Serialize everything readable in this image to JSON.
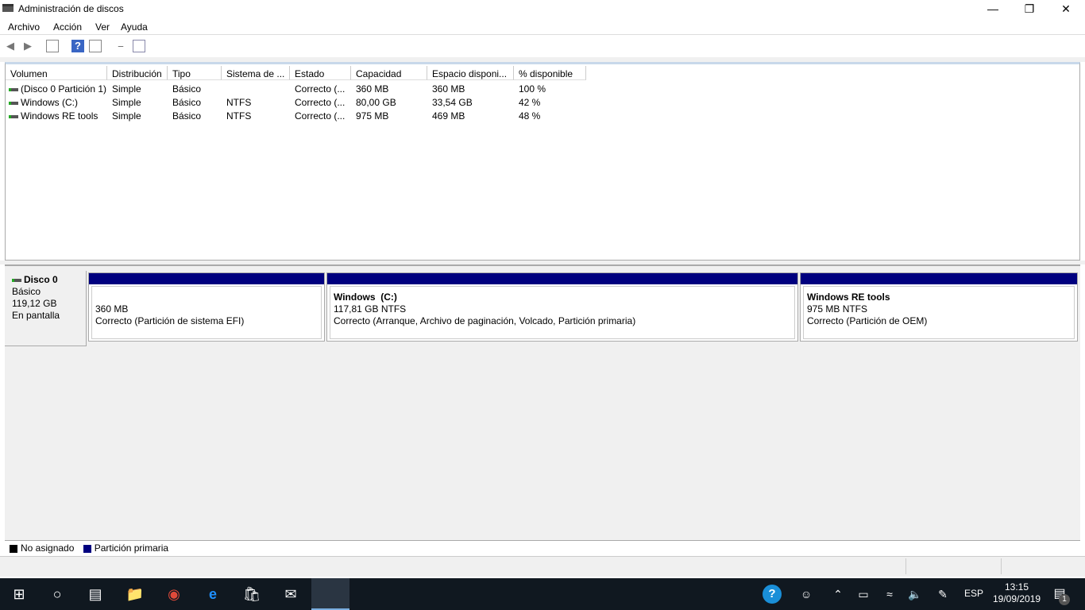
{
  "window": {
    "title": "Administración de discos"
  },
  "menu": [
    "Archivo",
    "Acción",
    "Ver",
    "Ayuda"
  ],
  "columns": [
    "Volumen",
    "Distribución",
    "Tipo",
    "Sistema de ...",
    "Estado",
    "Capacidad",
    "Espacio disponi...",
    "% disponible"
  ],
  "rows": [
    [
      "(Disco 0 Partición 1)",
      "Simple",
      "Básico",
      "",
      "Correcto (...",
      "360 MB",
      "360 MB",
      "100 %"
    ],
    [
      "Windows (C:)",
      "Simple",
      "Básico",
      "NTFS",
      "Correcto (...",
      "80,00 GB",
      "33,54 GB",
      "42 %"
    ],
    [
      "Windows RE tools",
      "Simple",
      "Básico",
      "NTFS",
      "Correcto (...",
      "975 MB",
      "469 MB",
      "48 %"
    ]
  ],
  "disk": {
    "name": "Disco 0",
    "type": "Básico",
    "size": "119,12 GB",
    "status": "En pantalla"
  },
  "partitions": [
    {
      "name": "",
      "size": "360 MB",
      "status": "Correcto (Partición de sistema EFI)"
    },
    {
      "name": "Windows  (C:)",
      "size": "117,81 GB NTFS",
      "status": "Correcto (Arranque, Archivo de paginación, Volcado, Partición primaria)"
    },
    {
      "name": "Windows RE tools",
      "size": "975 MB NTFS",
      "status": "Correcto (Partición de OEM)"
    }
  ],
  "legend": {
    "unallocated": "No asignado",
    "primary": "Partición primaria",
    "colors": {
      "unallocated": "#000000",
      "primary": "#00007f"
    }
  },
  "tray": {
    "lang": "ESP",
    "time": "13:15",
    "date": "19/09/2019",
    "notifications": "1"
  }
}
